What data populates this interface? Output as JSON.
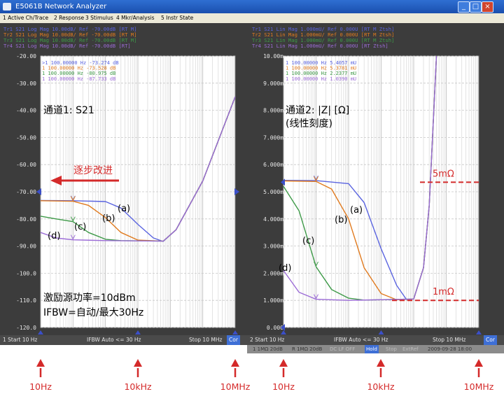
{
  "window": {
    "title": "E5061B Network Analyzer",
    "menu": [
      "1 Active Ch/Trace",
      "2 Response",
      "3 Stimulus",
      "4 Mkr/Analysis",
      "5 Instr State"
    ]
  },
  "colors": {
    "trace_a": "#5a64e0",
    "trace_b": "#e07a1e",
    "trace_c": "#3e9a48",
    "trace_d": "#9b6bd6",
    "arrow": "#d42a2a",
    "ref_marker": "#3b4fc8"
  },
  "chart_data": [
    {
      "type": "line",
      "channel_label": "通道1: S21",
      "trace_headers": [
        "Tr1 S21 Log Mag 10.00dB/ Ref -70.00dB [RT M]",
        "Tr2 S21 Log Mag 10.00dB/ Ref -70.00dB [RT M]",
        "Tr3 S21 Log Mag 10.00dB/ Ref -70.00dB [RT M]",
        "Tr4 S21 Log Mag 10.00dB/ Ref -70.00dB [RT]"
      ],
      "marker_readouts": [
        ">1  100.00000 Hz  -73.274 dB",
        " 1  100.00000 Hz  -73.528 dB",
        " 1  100.00000 Hz  -80.975 dB",
        " 1  100.00000 Hz  -87.733 dB"
      ],
      "y_ticks": [
        "-20.00",
        "-30.00",
        "-40.00",
        "-50.00",
        "-60.00",
        "-70.00",
        "-80.00",
        "-90.00",
        "-100.0",
        "-110.0",
        "-120.0"
      ],
      "ylim": [
        -120,
        -20
      ],
      "xlim": [
        10,
        10000000
      ],
      "x_scale": "log",
      "reference_level": -70,
      "series": [
        {
          "name": "(a)",
          "points": [
            [
              10,
              -73.2
            ],
            [
              100,
              -73.3
            ],
            [
              1000,
              -73.6
            ],
            [
              3000,
              -76
            ],
            [
              10000,
              -82
            ],
            [
              30000,
              -87
            ],
            [
              60000,
              -88.3
            ],
            [
              150000,
              -84
            ],
            [
              1000000,
              -66
            ],
            [
              10000000,
              -35
            ]
          ]
        },
        {
          "name": "(b)",
          "points": [
            [
              10,
              -73.3
            ],
            [
              100,
              -73.5
            ],
            [
              300,
              -75
            ],
            [
              1000,
              -79.5
            ],
            [
              3000,
              -85
            ],
            [
              10000,
              -87.8
            ],
            [
              60000,
              -88.2
            ],
            [
              150000,
              -84
            ],
            [
              1000000,
              -66
            ],
            [
              10000000,
              -35
            ]
          ]
        },
        {
          "name": "(c)",
          "points": [
            [
              10,
              -79
            ],
            [
              30,
              -80
            ],
            [
              100,
              -81
            ],
            [
              300,
              -85
            ],
            [
              1000,
              -87.5
            ],
            [
              3000,
              -88
            ],
            [
              60000,
              -88.2
            ],
            [
              150000,
              -84
            ],
            [
              1000000,
              -66
            ],
            [
              10000000,
              -35
            ]
          ]
        },
        {
          "name": "(d)",
          "points": [
            [
              10,
              -85
            ],
            [
              30,
              -87
            ],
            [
              100,
              -87.7
            ],
            [
              1000,
              -88
            ],
            [
              60000,
              -88.2
            ],
            [
              150000,
              -84
            ],
            [
              1000000,
              -66
            ],
            [
              10000000,
              -35
            ]
          ]
        }
      ],
      "annotations": {
        "improvement": "逐步改进",
        "excitation": "激励源功率=10dBm",
        "ifbw": "IFBW=自动/最大30Hz"
      },
      "status": {
        "start": "1  Start 10 Hz",
        "ifbw": "IFBW Auto <= 30 Hz",
        "stop": "Stop 10 MHz",
        "cor": "Cor"
      }
    },
    {
      "type": "line",
      "channel_label": "通道2: |Z| [Ω]",
      "channel_sublabel": "(线性刻度)",
      "trace_headers": [
        "Tr1 S21 Lin Mag 1.000mU/ Ref 0.000U [RT M Ztsh]",
        "Tr2 S21 Lin Mag 1.000mU/ Ref 0.000U [RT M Ztsh]",
        "Tr3 S21 Lin Mag 1.000mU/ Ref 0.000U [RT M Ztsh]",
        "Tr4 S21 Lin Mag 1.000mU/ Ref 0.000U [RT Ztsh]"
      ],
      "marker_readouts": [
        " 1  100.00000 Hz  5.4057 mU",
        " 1  100.00000 Hz  5.3781 mU",
        " 1  100.00000 Hz  2.2377 mU",
        " 1  100.00000 Hz  1.0390 mU"
      ],
      "y_ticks": [
        "10.00m",
        "9.000m",
        "8.000m",
        "7.000m",
        "6.000m",
        "5.000m",
        "4.000m",
        "3.000m",
        "2.000m",
        "1.000m",
        "0.000"
      ],
      "ylim": [
        0,
        10
      ],
      "y_unit": "mΩ",
      "xlim": [
        10,
        10000000
      ],
      "x_scale": "log",
      "levels": [
        {
          "label": "5mΩ",
          "value": 5.35
        },
        {
          "label": "1mΩ",
          "value": 1.0
        }
      ],
      "series": [
        {
          "name": "(a)",
          "points": [
            [
              10,
              5.42
            ],
            [
              100,
              5.41
            ],
            [
              1000,
              5.3
            ],
            [
              3000,
              4.6
            ],
            [
              10000,
              2.9
            ],
            [
              30000,
              1.55
            ],
            [
              60000,
              1.03
            ],
            [
              100000,
              1.05
            ],
            [
              200000,
              2.2
            ],
            [
              300000,
              4.5
            ],
            [
              500000,
              10
            ]
          ]
        },
        {
          "name": "(b)",
          "points": [
            [
              10,
              5.4
            ],
            [
              100,
              5.38
            ],
            [
              300,
              5.1
            ],
            [
              1000,
              4.0
            ],
            [
              3000,
              2.2
            ],
            [
              10000,
              1.25
            ],
            [
              30000,
              1.02
            ],
            [
              100000,
              1.05
            ],
            [
              200000,
              2.2
            ],
            [
              300000,
              4.5
            ],
            [
              500000,
              10
            ]
          ]
        },
        {
          "name": "(c)",
          "points": [
            [
              10,
              5.2
            ],
            [
              30,
              4.3
            ],
            [
              100,
              2.24
            ],
            [
              300,
              1.4
            ],
            [
              1000,
              1.08
            ],
            [
              3000,
              1.01
            ],
            [
              100000,
              1.05
            ],
            [
              200000,
              2.2
            ],
            [
              300000,
              4.5
            ],
            [
              500000,
              10
            ]
          ]
        },
        {
          "name": "(d)",
          "points": [
            [
              10,
              2.1
            ],
            [
              30,
              1.3
            ],
            [
              100,
              1.04
            ],
            [
              1000,
              1.0
            ],
            [
              100000,
              1.05
            ],
            [
              200000,
              2.2
            ],
            [
              300000,
              4.5
            ],
            [
              500000,
              10
            ]
          ]
        }
      ],
      "status": {
        "start": "2  Start 10 Hz",
        "ifbw": "IFBW Auto <= 30 Hz",
        "stop": "Stop 10 MHz",
        "cor": "Cor"
      }
    }
  ],
  "bottom_toolbar": [
    "1  1MΩ 20dB",
    "R  1MΩ 20dB",
    "DC LF OFF",
    "Hold",
    "Stop",
    "ExtRef",
    "2009-09-28 18:00"
  ],
  "freq_axis_labels": [
    "10Hz",
    "10kHz",
    "10MHz",
    "10Hz",
    "10kHz",
    "10MHz"
  ]
}
